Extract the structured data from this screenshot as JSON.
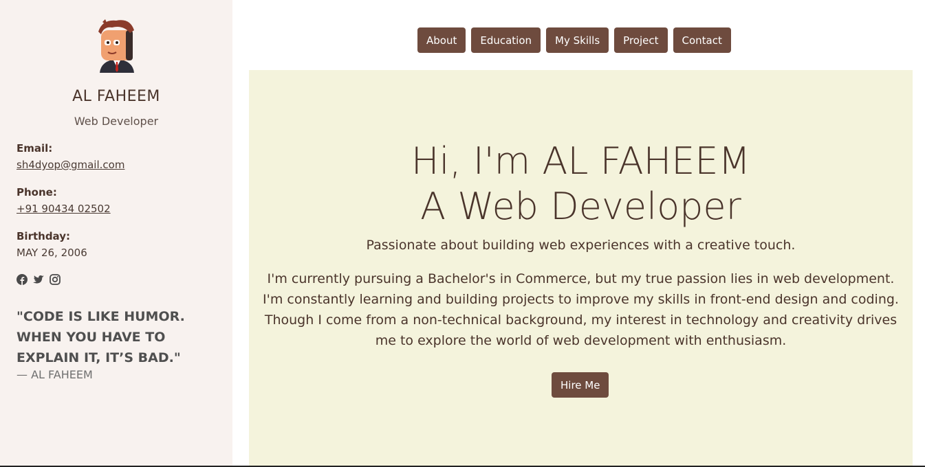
{
  "profile": {
    "name": "AL FAHEEM",
    "role": "Web Developer",
    "email_label": "Email:",
    "email": "sh4dyop@gmail.com",
    "phone_label": "Phone:",
    "phone": "+91 90434 02502",
    "birthday_label": "Birthday:",
    "birthday": "MAY 26, 2006",
    "socials": [
      "facebook-icon",
      "twitter-icon",
      "instagram-icon"
    ]
  },
  "quote": {
    "text": "\"CODE IS LIKE HUMOR. WHEN YOU HAVE TO EXPLAIN IT, IT’S BAD.\"",
    "author": "— AL FAHEEM"
  },
  "nav": {
    "items": [
      "About",
      "Education",
      "My Skills",
      "Project",
      "Contact"
    ]
  },
  "hero": {
    "title_line1": "Hi, I'm AL FAHEEM",
    "title_line2": "A Web Developer",
    "tagline": "Passionate about building web experiences with a creative touch.",
    "bio": "I'm currently pursuing a Bachelor's in Commerce, but my true passion lies in web development. I'm constantly learning and building projects to improve my skills in front-end design and coding. Though I come from a non-technical background, my interest in technology and creativity drives me to explore the world of web development with enthusiasm.",
    "cta": "Hire Me"
  },
  "colors": {
    "sidebar_bg": "#f8f2ef",
    "hero_bg": "#f4f3dc",
    "accent": "#6e4b3e",
    "text": "#4a342b"
  }
}
